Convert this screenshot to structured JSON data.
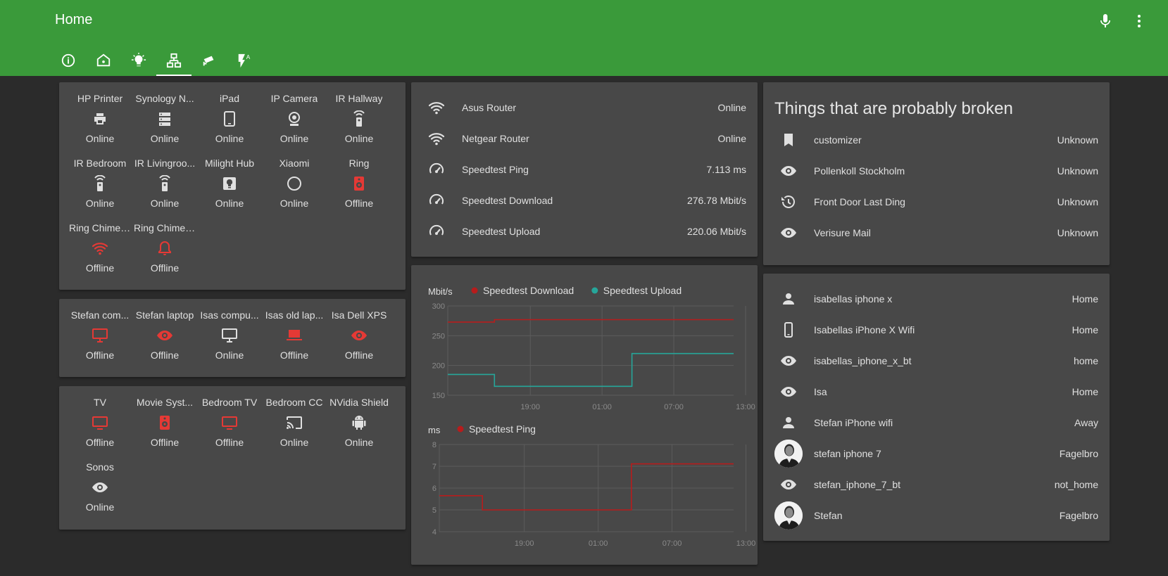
{
  "header": {
    "title": "Home",
    "mic_icon": "microphone-icon",
    "menu_icon": "more-vert-icon"
  },
  "tabs": [
    {
      "name": "tab-info",
      "icon": "info-icon"
    },
    {
      "name": "tab-home",
      "icon": "home-icon"
    },
    {
      "name": "tab-lights",
      "icon": "lightbulb-icon"
    },
    {
      "name": "tab-network",
      "icon": "network-icon",
      "active": true
    },
    {
      "name": "tab-cameras",
      "icon": "camera-icon"
    },
    {
      "name": "tab-automation",
      "icon": "flash-auto-icon"
    }
  ],
  "colors": {
    "header": "#3a9a3a",
    "offline": "#e53935",
    "icon": "#e0e0e0",
    "download": "#b71c1c",
    "upload": "#26a69a"
  },
  "devices": [
    {
      "name": "HP Printer",
      "state": "Online",
      "icon": "printer-icon"
    },
    {
      "name": "Synology N...",
      "state": "Online",
      "icon": "server-icon"
    },
    {
      "name": "iPad",
      "state": "Online",
      "icon": "tablet-icon"
    },
    {
      "name": "IP Camera",
      "state": "Online",
      "icon": "webcam-icon"
    },
    {
      "name": "IR Hallway",
      "state": "Online",
      "icon": "remote-icon"
    },
    {
      "name": "IR Bedroom",
      "state": "Online",
      "icon": "remote-icon"
    },
    {
      "name": "IR Livingroo...",
      "state": "Online",
      "icon": "remote-icon"
    },
    {
      "name": "Milight Hub",
      "state": "Online",
      "icon": "lightbulb-hub-icon"
    },
    {
      "name": "Xiaomi",
      "state": "Online",
      "icon": "circle-icon"
    },
    {
      "name": "Ring",
      "state": "Offline",
      "icon": "speaker-icon"
    },
    {
      "name": "Ring Chime ...",
      "state": "Offline",
      "icon": "wifi-icon"
    },
    {
      "name": "Ring Chime ...",
      "state": "Offline",
      "icon": "bell-icon"
    }
  ],
  "computers": [
    {
      "name": "Stefan com...",
      "state": "Offline",
      "icon": "monitor-icon"
    },
    {
      "name": "Stefan laptop",
      "state": "Offline",
      "icon": "eye-icon"
    },
    {
      "name": "Isas compu...",
      "state": "Online",
      "icon": "monitor-icon"
    },
    {
      "name": "Isas old lap...",
      "state": "Offline",
      "icon": "laptop-icon"
    },
    {
      "name": "Isa Dell XPS",
      "state": "Offline",
      "icon": "eye-icon"
    }
  ],
  "media": [
    {
      "name": "TV",
      "state": "Offline",
      "icon": "tv-icon"
    },
    {
      "name": "Movie Syst...",
      "state": "Offline",
      "icon": "speaker-icon"
    },
    {
      "name": "Bedroom TV",
      "state": "Offline",
      "icon": "tv-icon"
    },
    {
      "name": "Bedroom CC",
      "state": "Online",
      "icon": "cast-icon"
    },
    {
      "name": "NVidia Shield",
      "state": "Online",
      "icon": "android-icon"
    },
    {
      "name": "Sonos",
      "state": "Online",
      "icon": "eye-icon"
    }
  ],
  "network": [
    {
      "name": "Asus Router",
      "value": "Online",
      "icon": "wifi-icon"
    },
    {
      "name": "Netgear Router",
      "value": "Online",
      "icon": "wifi-icon"
    },
    {
      "name": "Speedtest Ping",
      "value": "7.113 ms",
      "icon": "speedometer-icon"
    },
    {
      "name": "Speedtest Download",
      "value": "276.78 Mbit/s",
      "icon": "speedometer-icon"
    },
    {
      "name": "Speedtest Upload",
      "value": "220.06 Mbit/s",
      "icon": "speedometer-icon"
    }
  ],
  "broken": {
    "title": "Things that are probably broken",
    "items": [
      {
        "name": "customizer",
        "value": "Unknown",
        "icon": "bookmark-icon"
      },
      {
        "name": "Pollenkoll Stockholm",
        "value": "Unknown",
        "icon": "eye-icon"
      },
      {
        "name": "Front Door Last Ding",
        "value": "Unknown",
        "icon": "history-icon"
      },
      {
        "name": "Verisure Mail",
        "value": "Unknown",
        "icon": "eye-icon"
      }
    ]
  },
  "people": [
    {
      "name": "isabellas iphone x",
      "value": "Home",
      "icon": "person-icon"
    },
    {
      "name": "Isabellas iPhone X Wifi",
      "value": "Home",
      "icon": "cellphone-icon"
    },
    {
      "name": "isabellas_iphone_x_bt",
      "value": "home",
      "icon": "eye-icon"
    },
    {
      "name": "Isa",
      "value": "Home",
      "icon": "eye-icon"
    },
    {
      "name": "Stefan iPhone wifi",
      "value": "Away",
      "icon": "person-icon"
    },
    {
      "name": "stefan iphone 7",
      "value": "Fagelbro",
      "icon": "avatar-photo"
    },
    {
      "name": "stefan_iphone_7_bt",
      "value": "not_home",
      "icon": "eye-icon"
    },
    {
      "name": "Stefan",
      "value": "Fagelbro",
      "icon": "avatar-photo"
    }
  ],
  "chart_data": [
    {
      "type": "line",
      "ylabel": "Mbit/s",
      "ylim": [
        150,
        300
      ],
      "yticks": [
        150,
        200,
        250,
        300
      ],
      "xticks": [
        "19:00",
        "01:00",
        "07:00",
        "13:00"
      ],
      "x_range_hours": [
        -3.9,
        20.0
      ],
      "step": true,
      "series": [
        {
          "name": "Speedtest Download",
          "x": [
            -3.9,
            0.0,
            0.0,
            20.0
          ],
          "values": [
            273,
            273,
            277,
            277
          ]
        },
        {
          "name": "Speedtest Upload",
          "x": [
            -3.9,
            0.0,
            0.0,
            11.5,
            11.5,
            20.0
          ],
          "values": [
            185,
            185,
            165,
            165,
            220,
            220
          ]
        }
      ]
    },
    {
      "type": "line",
      "ylabel": "ms",
      "ylim": [
        4,
        8
      ],
      "yticks": [
        4,
        5,
        6,
        7,
        8
      ],
      "xticks": [
        "19:00",
        "01:00",
        "07:00",
        "13:00"
      ],
      "x_range_hours": [
        -3.9,
        20.0
      ],
      "step": true,
      "series": [
        {
          "name": "Speedtest Ping",
          "x": [
            -3.9,
            -0.4,
            -0.4,
            11.7,
            11.7,
            20.0
          ],
          "values": [
            5.65,
            5.65,
            5.0,
            5.0,
            7.11,
            7.11
          ]
        }
      ]
    }
  ]
}
